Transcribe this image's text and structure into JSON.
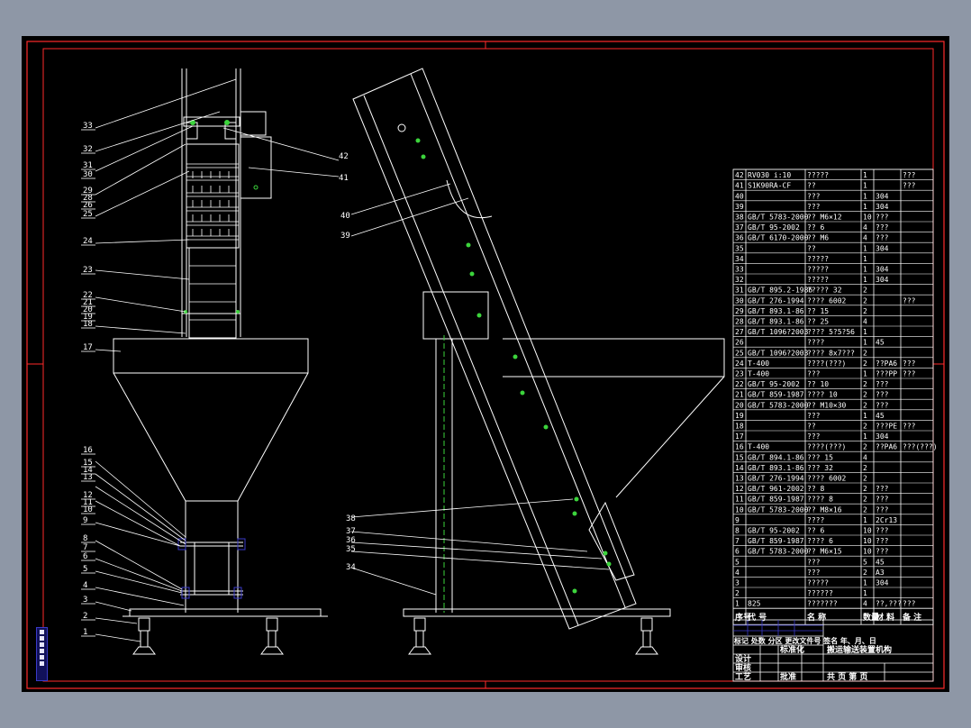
{
  "colors": {
    "background": "#8e97a6",
    "sheet": "#000000",
    "border": "#ff2a2a",
    "line": "#ffffff",
    "center": "#38d838",
    "accent": "#3a3ac8"
  },
  "left_view_labels": [
    "33",
    "32",
    "31",
    "30",
    "29",
    "28",
    "26",
    "25",
    "24",
    "23",
    "22",
    "21",
    "20",
    "19",
    "18",
    "17",
    "16",
    "15",
    "14",
    "13",
    "12",
    "11",
    "10",
    "9",
    "8",
    "7",
    "6",
    "5",
    "4",
    "3",
    "2",
    "1"
  ],
  "right_view_labels": [
    "42",
    "41",
    "40",
    "39",
    "38",
    "37",
    "36",
    "35",
    "34"
  ],
  "bom": {
    "rows": [
      [
        "42",
        "RV030 i:10",
        "?????",
        "1",
        "",
        "???"
      ],
      [
        "41",
        "S1K90RA-CF",
        "??",
        "1",
        "",
        "???"
      ],
      [
        "40",
        "",
        "???",
        "1",
        "304",
        ""
      ],
      [
        "39",
        "",
        "???",
        "1",
        "304",
        ""
      ],
      [
        "38",
        "GB/T 5783-2000",
        "?? M6×12",
        "10",
        "???",
        ""
      ],
      [
        "37",
        "GB/T 95-2002",
        "?? 6",
        "4",
        "???",
        ""
      ],
      [
        "36",
        "GB/T 6170-2000",
        "?? M6",
        "4",
        "???",
        ""
      ],
      [
        "35",
        "",
        "??",
        "1",
        "304",
        ""
      ],
      [
        "34",
        "",
        "?????",
        "1",
        "",
        ""
      ],
      [
        "33",
        "",
        "?????",
        "1",
        "304",
        ""
      ],
      [
        "32",
        "",
        "?????",
        "1",
        "304",
        ""
      ],
      [
        "31",
        "GB/T 895.2-1986",
        "????? 32",
        "2",
        "",
        ""
      ],
      [
        "30",
        "GB/T 276-1994",
        "???? 6002",
        "2",
        "",
        "???"
      ],
      [
        "29",
        "GB/T 893.1-86",
        "?? 15",
        "2",
        "",
        ""
      ],
      [
        "28",
        "GB/T 893.1-86",
        "?? 25",
        "4",
        "",
        ""
      ],
      [
        "27",
        "GB/T 1096?2003",
        "???? 5?5?56",
        "1",
        "",
        ""
      ],
      [
        "26",
        "",
        "????",
        "1",
        "45",
        ""
      ],
      [
        "25",
        "GB/T 1096?2003",
        "???? 8x7???",
        "2",
        "",
        ""
      ],
      [
        "24",
        "T-400",
        "????(???)",
        "2",
        "??PA6",
        "???"
      ],
      [
        "23",
        "T-400",
        "???",
        "1",
        "???PP",
        "???"
      ],
      [
        "22",
        "GB/T 95-2002",
        "?? 10",
        "2",
        "???",
        ""
      ],
      [
        "21",
        "GB/T 859-1987",
        "???? 10",
        "2",
        "???",
        ""
      ],
      [
        "20",
        "GB/T 5783-2000",
        "?? M10×30",
        "2",
        "???",
        ""
      ],
      [
        "19",
        "",
        "???",
        "1",
        "45",
        ""
      ],
      [
        "18",
        "",
        "??",
        "2",
        "???PE",
        "???"
      ],
      [
        "17",
        "",
        "???",
        "1",
        "304",
        ""
      ],
      [
        "16",
        "T-400",
        "????(???)",
        "2",
        "??PA6",
        "???(???)"
      ],
      [
        "15",
        "GB/T 894.1-86",
        "??? 15",
        "4",
        "",
        ""
      ],
      [
        "14",
        "GB/T 893.1-86",
        "??? 32",
        "2",
        "",
        ""
      ],
      [
        "13",
        "GB/T 276-1994",
        "???? 6002",
        "2",
        "",
        ""
      ],
      [
        "12",
        "GB/T 961-2002",
        "?? 8",
        "2",
        "???",
        ""
      ],
      [
        "11",
        "GB/T 859-1987",
        "???? 8",
        "2",
        "???",
        ""
      ],
      [
        "10",
        "GB/T 5783-2000",
        "?? M8×16",
        "2",
        "???",
        ""
      ],
      [
        "9",
        "",
        "????",
        "1",
        "2Cr13",
        ""
      ],
      [
        "8",
        "GB/T 95-2002",
        "?? 6",
        "10",
        "???",
        ""
      ],
      [
        "7",
        "GB/T 859-1987",
        "???? 6",
        "10",
        "???",
        ""
      ],
      [
        "6",
        "GB/T 5783-2000",
        "?? M6×15",
        "10",
        "???",
        ""
      ],
      [
        "5",
        "",
        "???",
        "5",
        "45",
        ""
      ],
      [
        "4",
        "",
        "???",
        "2",
        "A3",
        ""
      ],
      [
        "3",
        "",
        "?????",
        "1",
        "304",
        ""
      ],
      [
        "2",
        "",
        "??????",
        "1",
        "",
        ""
      ],
      [
        "1",
        "825",
        "???????",
        "4",
        "??,???",
        "???"
      ]
    ],
    "header": [
      "序号",
      "代  号",
      "名  称",
      "数量",
      "材  料",
      "备  注"
    ]
  },
  "title_block": {
    "drawing_name": "搬运输送装置机构",
    "left_lines": [
      "标记 处数 分区 更改文件号 签名 年、月、日",
      "设计",
      "审核",
      "工艺",
      "批准"
    ],
    "right_line": "共  页  第  页",
    "std": "标准化"
  }
}
